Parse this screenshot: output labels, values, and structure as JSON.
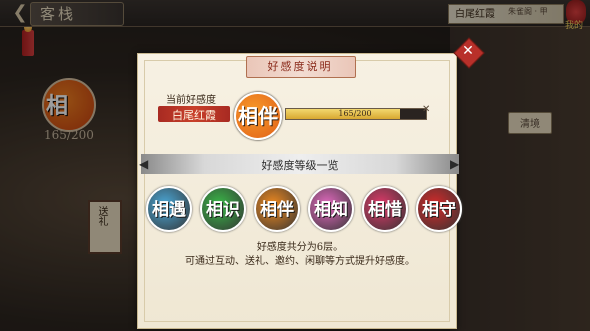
{
  "topbar": {
    "back_icon": "back-arrow-icon",
    "title": "客栈",
    "npc_name": "白尾红霞",
    "npc_location": "朱雀阁 · 甲",
    "lantern_label": "我的"
  },
  "left_panel": {
    "badge_glyph": "相",
    "affinity_count": "165/200",
    "sign_text": "送礼"
  },
  "right_panel": {
    "button_label": "清境"
  },
  "dialog": {
    "header_title": "好感度说明",
    "current_label": "当前好感度",
    "npc_name": "白尾红霞",
    "current_badge_glyph": "相伴",
    "progress_text": "165/200",
    "progress_value": 165,
    "progress_max": 200,
    "levels_title": "好感度等级一览",
    "levels": [
      {
        "glyph": "相遇",
        "color": "#4aa8d8"
      },
      {
        "glyph": "相识",
        "color": "#3ab848"
      },
      {
        "glyph": "相伴",
        "color": "#f08a20"
      },
      {
        "glyph": "相知",
        "color": "#e46ac0"
      },
      {
        "glyph": "相惜",
        "color": "#e03a6a"
      },
      {
        "glyph": "相守",
        "color": "#d42a2a"
      }
    ],
    "desc_line1": "好感度共分为6层。",
    "desc_line2": "可通过互动、送礼、邀约、闲聊等方式提升好感度。"
  },
  "colors": {
    "accent_red": "#b8302a",
    "progress_gold": "#d8a830",
    "paper": "#f7f1e3"
  }
}
